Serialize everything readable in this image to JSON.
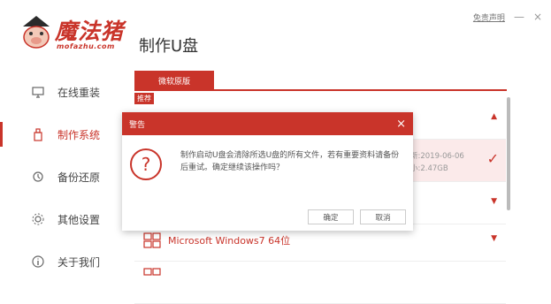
{
  "header": {
    "logo_cn": "魔法猪",
    "logo_en": "mofazhu.com",
    "title": "制作U盘",
    "disclaimer": "免责声明",
    "minimize": "—",
    "close": "×"
  },
  "sidebar": {
    "items": [
      {
        "label": "在线重装",
        "icon": "monitor-icon"
      },
      {
        "label": "制作系统",
        "icon": "usb-icon"
      },
      {
        "label": "备份还原",
        "icon": "backup-icon"
      },
      {
        "label": "其他设置",
        "icon": "settings-icon"
      },
      {
        "label": "关于我们",
        "icon": "info-icon"
      }
    ]
  },
  "tabs": {
    "active": "微软原版",
    "recommend_badge": "推荐"
  },
  "list": {
    "selected_meta_line1": "新:2019-06-06",
    "selected_meta_line2": "小:2.47GB",
    "win7_name": "Microsoft Windows7 64位",
    "arrow_up": "▲",
    "arrow_down": "▼",
    "check": "✓"
  },
  "dialog": {
    "title": "警告",
    "close": "×",
    "icon": "?",
    "message": "制作启动U盘会清除所选U盘的所有文件，若有重要资料请备份后重试。确定继续该操作吗？",
    "ok_label": "确定",
    "cancel_label": "取消"
  },
  "colors": {
    "accent": "#c9342a",
    "selected_row": "#fbeaea"
  }
}
